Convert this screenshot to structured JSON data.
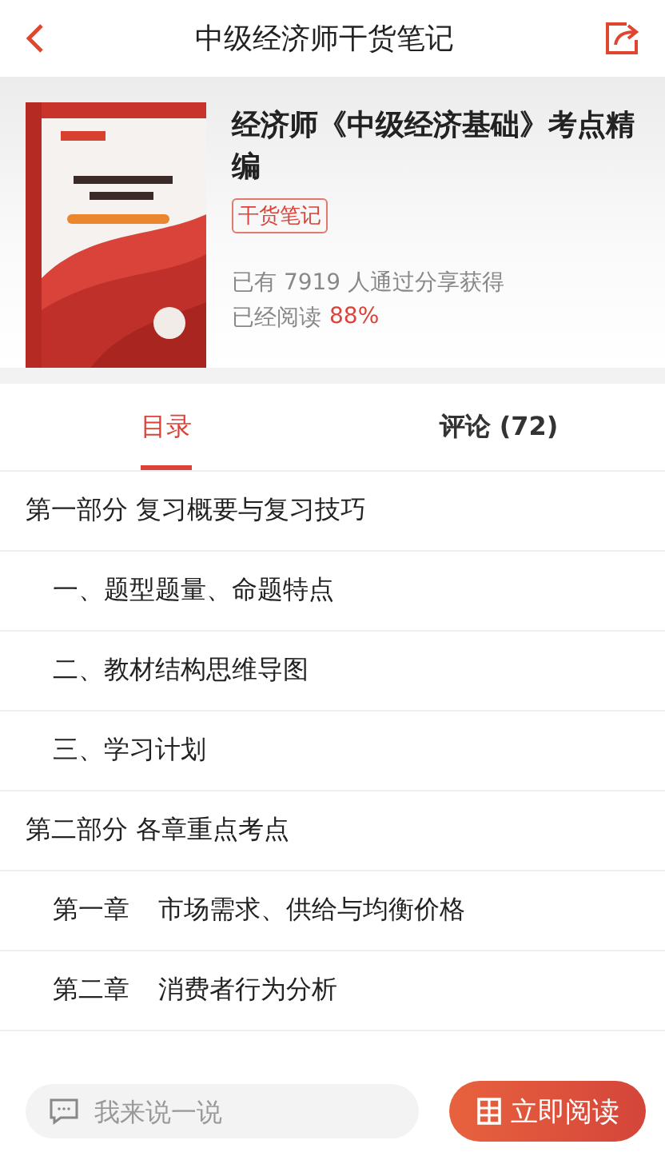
{
  "header": {
    "title": "中级经济师干货笔记"
  },
  "book": {
    "title": "经济师《中级经济基础》考点精编",
    "tag": "干货笔记",
    "share_text": "已有 7919 人通过分享获得",
    "read_label": "已经阅读",
    "read_percent": "88%"
  },
  "tabs": [
    {
      "label": "目录",
      "selected": true
    },
    {
      "label": "评论 (72)",
      "selected": false
    }
  ],
  "toc": [
    {
      "label": "第一部分 复习概要与复习技巧",
      "children": [
        {
          "label": "一、题型题量、命题特点"
        },
        {
          "label": "二、教材结构思维导图"
        },
        {
          "label": "三、学习计划"
        }
      ]
    },
    {
      "label": "第二部分 各章重点考点",
      "children": [
        {
          "number": "第一章",
          "label": "市场需求、供给与均衡价格"
        },
        {
          "number": "第二章",
          "label": "消费者行为分析"
        }
      ]
    }
  ],
  "bottom_bar": {
    "comment_placeholder": "我来说一说",
    "read_button": "立即阅读"
  }
}
